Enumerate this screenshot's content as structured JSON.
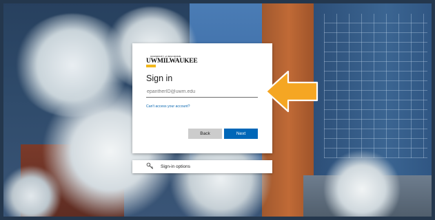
{
  "logo": {
    "top_text": "UNIVERSITY of WISCONSIN",
    "main_text": "UWMILWAUKEE"
  },
  "signin": {
    "title": "Sign in",
    "email_placeholder": "epantherID@uwm.edu",
    "email_value": "",
    "cant_access_link": "Can't access your account?",
    "back_label": "Back",
    "next_label": "Next"
  },
  "options": {
    "label": "Sign-in options",
    "icon": "key-icon"
  },
  "annotation": {
    "icon": "arrow-left-icon",
    "color": "#f5a623"
  },
  "colors": {
    "accent": "#0067b8",
    "link": "#0a67b0",
    "logo_gold": "#f2b71c"
  }
}
